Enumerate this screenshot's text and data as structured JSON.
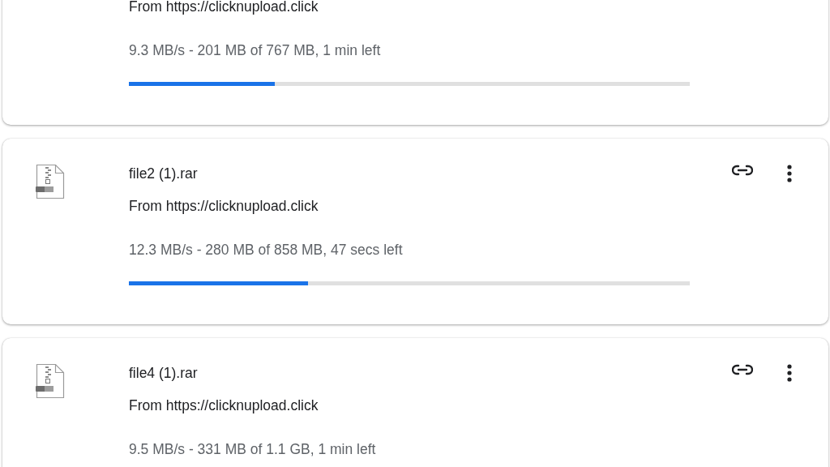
{
  "downloads": [
    {
      "source": "From https://clicknupload.click",
      "status": "9.3 MB/s - 201 MB of 767 MB, 1 min left",
      "level": 0.26
    },
    {
      "name": "file2 (1).rar",
      "source": "From https://clicknupload.click",
      "status": "12.3 MB/s - 280 MB of 858 MB, 47 secs left",
      "level": 0.32
    },
    {
      "name": "file4 (1).rar",
      "source": "From https://clicknupload.click",
      "status": "9.5 MB/s - 331 MB of 1.1 GB, 1 min left"
    }
  ]
}
